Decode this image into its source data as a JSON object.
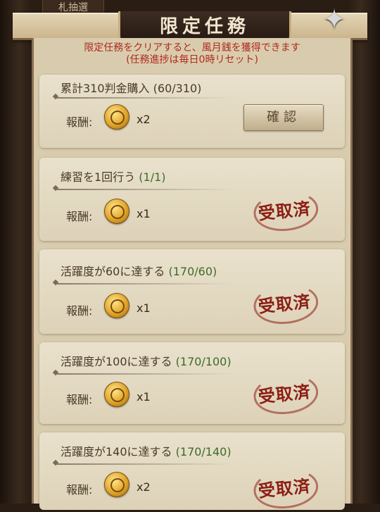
{
  "background": {
    "tab_label": "札抽選"
  },
  "header": {
    "title": "限定任務",
    "close_icon": "shuriken-icon"
  },
  "notice": {
    "line1": "限定任務をクリアすると、風月銭を獲得できます",
    "line2": "(任務進捗は毎日0時リセット)"
  },
  "reward_label": "報酬:",
  "tasks": [
    {
      "title": "累計310判金購入",
      "progress": "(60/310)",
      "quantity": "x2",
      "status": "confirm",
      "button_label": "確認"
    },
    {
      "title": "練習を1回行う",
      "progress": "(1/1)",
      "quantity": "x1",
      "status": "claimed",
      "stamp_text": "受取済"
    },
    {
      "title": "活躍度が60に達する",
      "progress": "(170/60)",
      "quantity": "x1",
      "status": "claimed",
      "stamp_text": "受取済"
    },
    {
      "title": "活躍度が100に達する",
      "progress": "(170/100)",
      "quantity": "x1",
      "status": "claimed",
      "stamp_text": "受取済"
    },
    {
      "title": "活躍度が140に達する",
      "progress": "(170/140)",
      "quantity": "x2",
      "status": "claimed",
      "stamp_text": "受取済"
    }
  ],
  "colors": {
    "notice_red": "#b0291c",
    "progress_green": "#3d6b2a",
    "stamp_red": "#8c1e14"
  }
}
